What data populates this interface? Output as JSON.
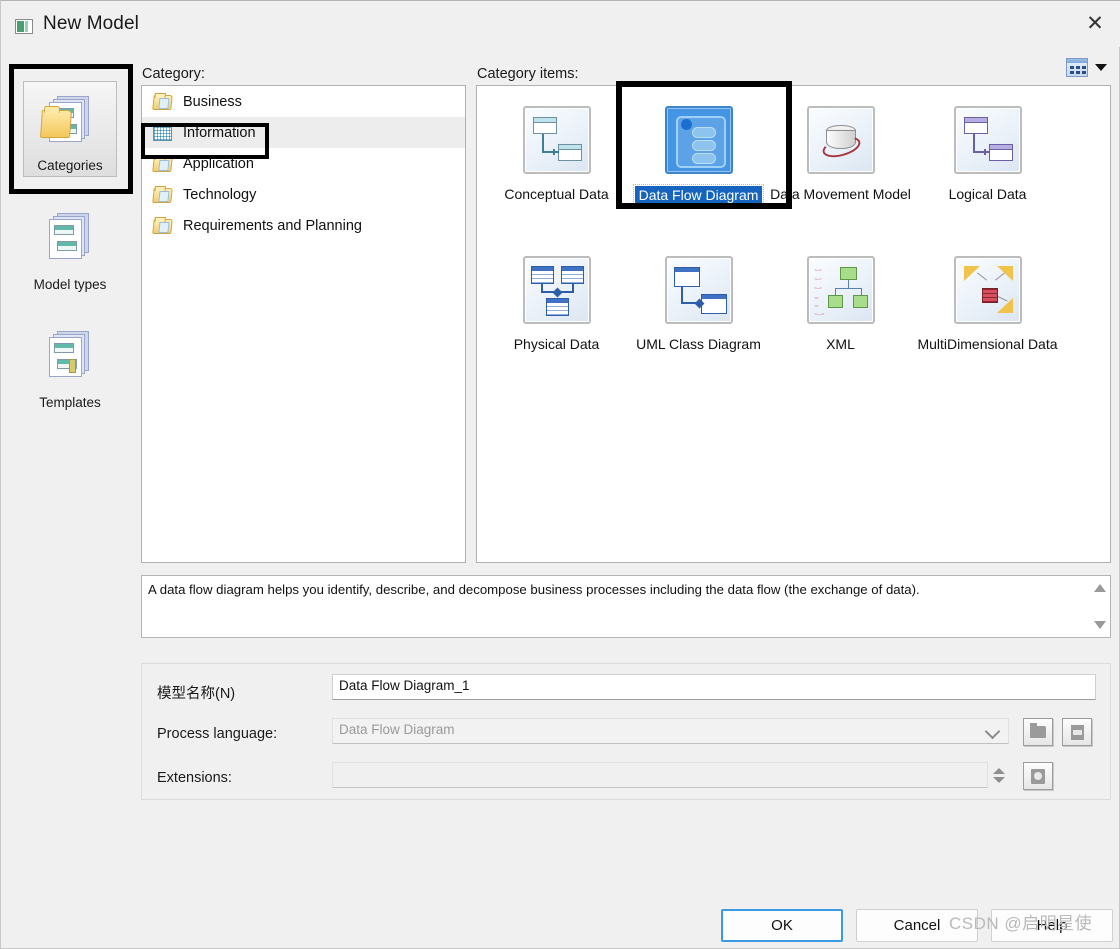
{
  "window": {
    "title": "New Model",
    "app_icon": "window-icon",
    "close_label": "✕"
  },
  "rail": {
    "items": [
      {
        "id": "categories",
        "label": "Categories",
        "icon": "folder-documents-icon",
        "selected": true
      },
      {
        "id": "model-types",
        "label": "Model types",
        "icon": "stacked-documents-icon",
        "selected": false
      },
      {
        "id": "templates",
        "label": "Templates",
        "icon": "template-documents-icon",
        "selected": false
      }
    ]
  },
  "labels": {
    "category": "Category:",
    "category_items": "Category items:"
  },
  "view_toggle": {
    "icon": "list-view-icon",
    "arrow": "chevron-down-icon"
  },
  "category_tree": {
    "items": [
      {
        "label": "Business",
        "icon": "folder-icon",
        "selected": false
      },
      {
        "label": "Information",
        "icon": "grid-icon",
        "selected": true
      },
      {
        "label": "Application",
        "icon": "folder-icon",
        "selected": false
      },
      {
        "label": "Technology",
        "icon": "folder-icon",
        "selected": false
      },
      {
        "label": "Requirements and Planning",
        "icon": "folder-icon",
        "selected": false
      }
    ]
  },
  "category_items": {
    "items": [
      {
        "label": "Conceptual Data",
        "icon": "conceptual-data-icon",
        "selected": false
      },
      {
        "label": "Data Flow Diagram",
        "icon": "data-flow-diagram-icon",
        "selected": true
      },
      {
        "label": "Data Movement Model",
        "icon": "data-movement-model-icon",
        "selected": false
      },
      {
        "label": "Logical Data",
        "icon": "logical-data-icon",
        "selected": false
      },
      {
        "label": "Physical Data",
        "icon": "physical-data-icon",
        "selected": false
      },
      {
        "label": "UML Class Diagram",
        "icon": "uml-class-diagram-icon",
        "selected": false
      },
      {
        "label": "XML",
        "icon": "xml-icon",
        "selected": false
      },
      {
        "label": "MultiDimensional Data",
        "icon": "multidimensional-data-icon",
        "selected": false
      }
    ]
  },
  "description": {
    "text": "A data flow diagram helps you identify, describe, and decompose business processes including the data flow (the exchange of data)."
  },
  "form": {
    "name_label": "模型名称(N)",
    "name_value": "Data Flow Diagram_1",
    "process_language_label": "Process language:",
    "process_language_value": "Data Flow Diagram",
    "extensions_label": "Extensions:",
    "extensions_value": "",
    "browse_icon": "folder-button-icon",
    "import_icon": "import-document-icon",
    "extend_icon": "extension-document-icon"
  },
  "footer": {
    "ok": "OK",
    "cancel": "Cancel",
    "help": "Help"
  },
  "watermark": {
    "text": "CSDN @启明星使"
  },
  "colors": {
    "accent": "#3b9ae1",
    "selection": "#1565c0",
    "dialog_bg": "#f0f0f0",
    "annotation": "#000000"
  }
}
